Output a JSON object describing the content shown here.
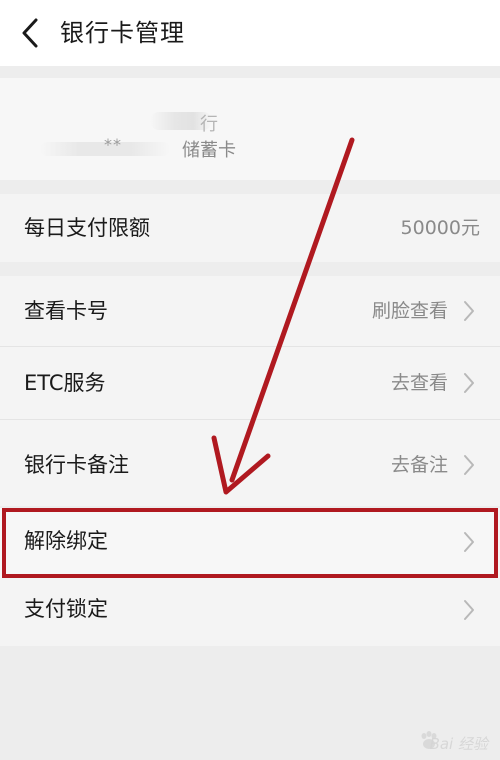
{
  "header": {
    "title": "银行卡管理",
    "back_icon": "chevron-left-icon"
  },
  "card": {
    "bank_name_fragment": "行",
    "number_mask": "**",
    "type": "储蓄卡"
  },
  "limit_row": {
    "label": "每日支付限额",
    "value": "50000元"
  },
  "menu": [
    {
      "label": "查看卡号",
      "value": "刷脸查看"
    },
    {
      "label": "ETC服务",
      "value": "去查看"
    },
    {
      "label": "银行卡备注",
      "value": "去备注"
    },
    {
      "label": "解除绑定",
      "value": ""
    },
    {
      "label": "支付锁定",
      "value": ""
    }
  ],
  "annotations": {
    "arrow_color": "#b01920",
    "highlight_color": "#b01920"
  },
  "watermark": {
    "text": "Bai 经验",
    "icon": "baidu-paw-icon"
  },
  "colors": {
    "background": "#ededed",
    "row_background": "#f4f4f4",
    "secondary_text": "#8a8a8a"
  }
}
